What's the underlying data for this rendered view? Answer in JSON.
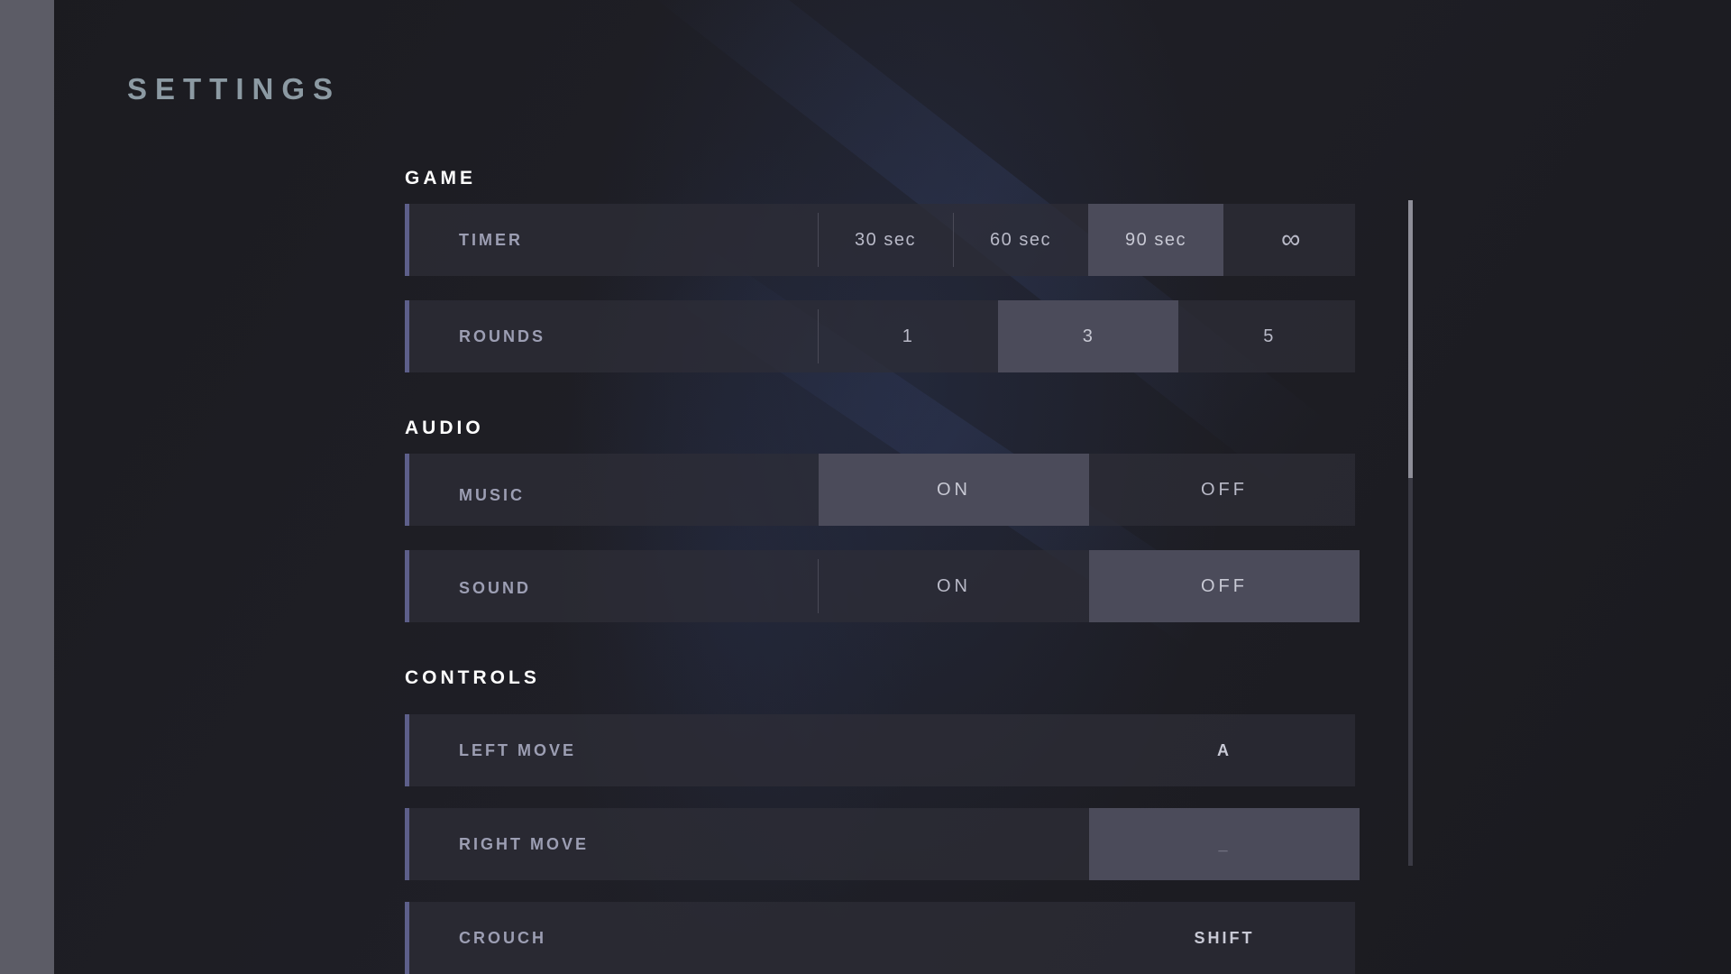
{
  "title": "SETTINGS",
  "sections": {
    "game": {
      "title": "GAME",
      "timer": {
        "label": "TIMER",
        "options": [
          "30 sec",
          "60 sec",
          "90 sec",
          "∞"
        ],
        "selected": "90 sec"
      },
      "rounds": {
        "label": "ROUNDS",
        "options": [
          "1",
          "3",
          "5"
        ],
        "selected": "3"
      }
    },
    "audio": {
      "title": "AUDIO",
      "music": {
        "label": "MUSIC",
        "options": [
          "ON",
          "OFF"
        ],
        "selected": "ON"
      },
      "sound": {
        "label": "SOUND",
        "options": [
          "ON",
          "OFF"
        ],
        "selected": "OFF"
      }
    },
    "controls": {
      "title": "CONTROLS",
      "left_move": {
        "label": "LEFT MOVE",
        "key": "A"
      },
      "right_move": {
        "label": "RIGHT MOVE",
        "key": "_"
      },
      "crouch": {
        "label": "CROUCH",
        "key": "SHIFT"
      }
    }
  },
  "scroll": {
    "position": 0.0
  },
  "colors": {
    "accent": "#5d5f8a",
    "selected_bg": "#4b4b5a",
    "row_bg": "#2e2e38",
    "title": "#8c9aa3"
  }
}
